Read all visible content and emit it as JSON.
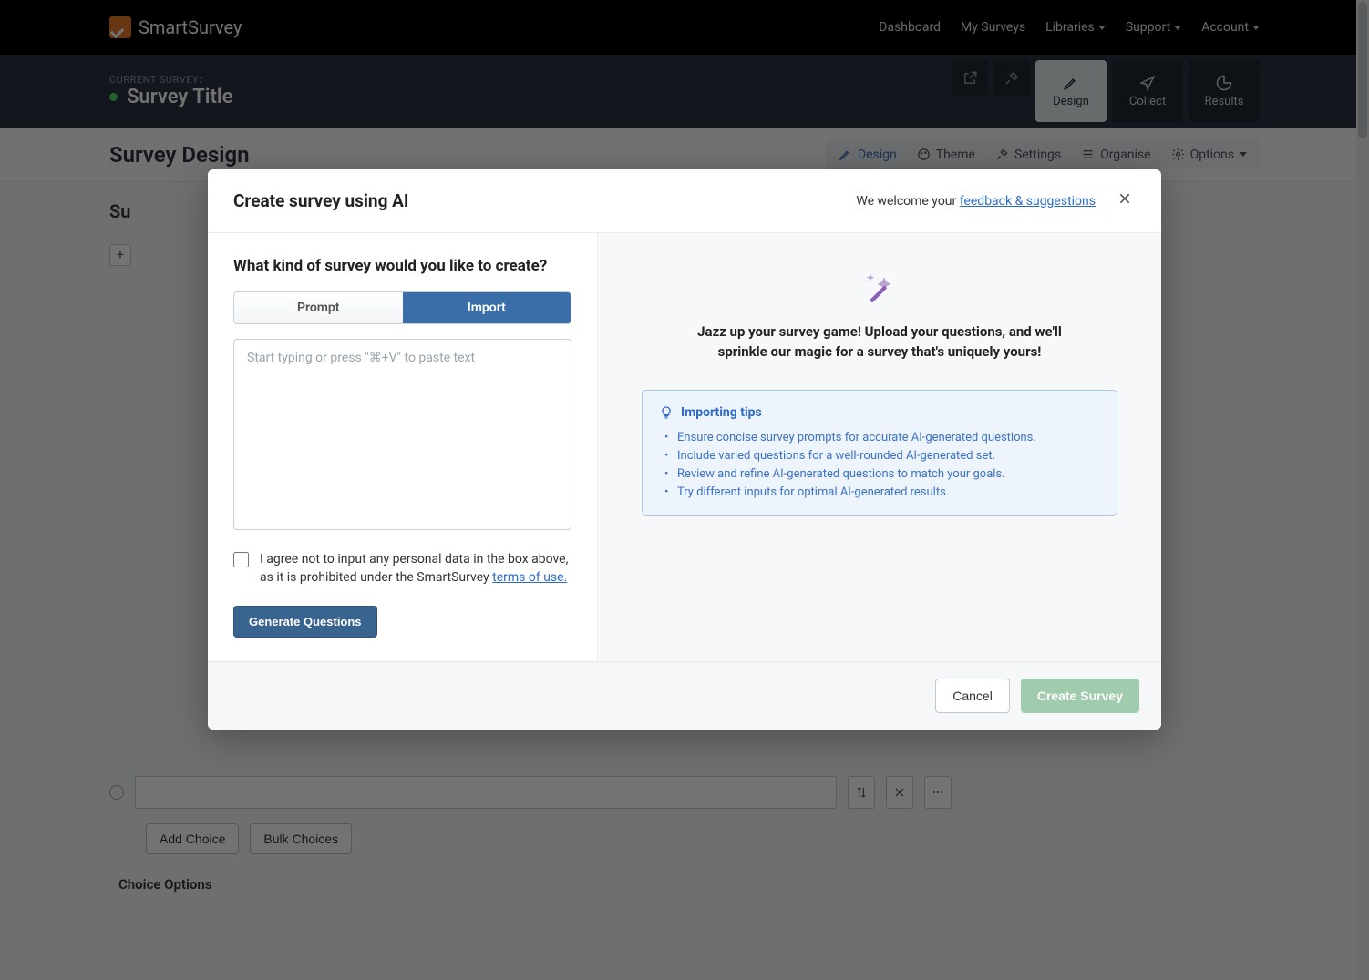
{
  "brand": "SmartSurvey",
  "topnav": {
    "items": [
      "Dashboard",
      "My Surveys",
      "Libraries",
      "Support",
      "Account"
    ],
    "dropdown_flags": [
      false,
      false,
      true,
      true,
      true
    ]
  },
  "survey_header": {
    "current_label": "CURRENT SURVEY:",
    "title": "Survey Title",
    "modes": [
      "Design",
      "Collect",
      "Results"
    ],
    "active_mode_index": 0
  },
  "subbar": {
    "title": "Survey Design",
    "actions": [
      "Design",
      "Theme",
      "Settings",
      "Organise",
      "Options"
    ],
    "active_index": 0
  },
  "bg": {
    "partial_heading": "Su",
    "add_choice": "Add Choice",
    "bulk_choices": "Bulk Choices",
    "choice_options": "Choice Options"
  },
  "modal": {
    "title": "Create survey using AI",
    "feedback_prefix": "We welcome your ",
    "feedback_link": "feedback & suggestions",
    "question_heading": "What kind of survey would you like to create?",
    "tabs": {
      "prompt": "Prompt",
      "import": "Import",
      "active": "import"
    },
    "textarea_placeholder": "Start typing or press \"⌘+V\" to paste text",
    "consent_text_prefix": "I agree not to input any personal data in the box above, as it is prohibited under the SmartSurvey ",
    "consent_link": "terms of use.",
    "generate_btn": "Generate Questions",
    "promo_text": "Jazz up your survey game! Upload your questions, and we'll sprinkle our magic for a survey that's uniquely yours!",
    "tips_title": "Importing tips",
    "tips": [
      "Ensure concise survey prompts for accurate AI-generated questions.",
      "Include varied questions for a well-rounded AI-generated set.",
      "Review and refine AI-generated questions to match your goals.",
      "Try different inputs for optimal AI-generated results."
    ],
    "cancel": "Cancel",
    "create": "Create Survey"
  }
}
